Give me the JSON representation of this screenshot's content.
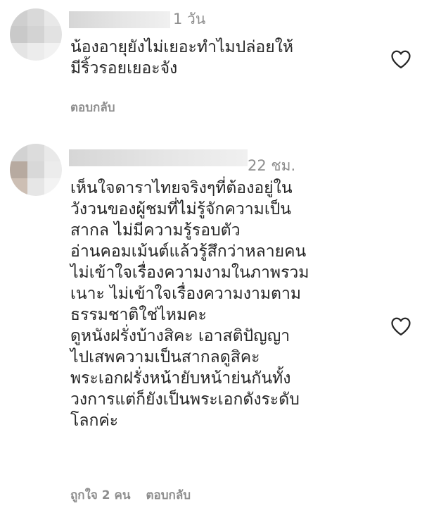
{
  "comments": [
    {
      "time": "1 วัน",
      "lines": [
        "น้องอายุยังไม่เยอะทำไมปล่อยให้",
        "มีริ้วรอยเยอะจัง"
      ],
      "reply_label": "ตอบกลับ",
      "icon": "heart-outline-icon"
    },
    {
      "time": "22 ชม.",
      "lines": [
        "เห็นใจดาราไทยจริงๆที่ต้องอยู่ใน",
        "วังวนของผู้ชมที่ไม่รู้จักความเป็น",
        "สากล ไม่มีความรู้รอบตัว",
        "อ่านคอมเม้นต์แล้วรู้สึกว่าหลายคน",
        "ไม่เข้าใจเรื่องความงามในภาพรวม",
        "เนาะ ไม่เข้าใจเรื่องความงามตาม",
        "ธรรมชาติใช่ไหมคะ",
        "ดูหนังฝรั่งบ้างสิคะ เอาสติปัญญา",
        "ไปเสพความเป็นสากลดูสิคะ",
        "พระเอกฝรั่งหน้ายับหน้าย่นกันทั้ง",
        "วงการแต่ก็ยังเป็นพระเอกดังระดับ",
        "โลกค่ะ"
      ],
      "likes_label": "ถูกใจ 2 คน",
      "reply_label": "ตอบกลับ",
      "icon": "heart-outline-icon"
    }
  ],
  "colors": {
    "text": "#262626",
    "meta": "#8e8e8e",
    "heart": "#262626"
  }
}
